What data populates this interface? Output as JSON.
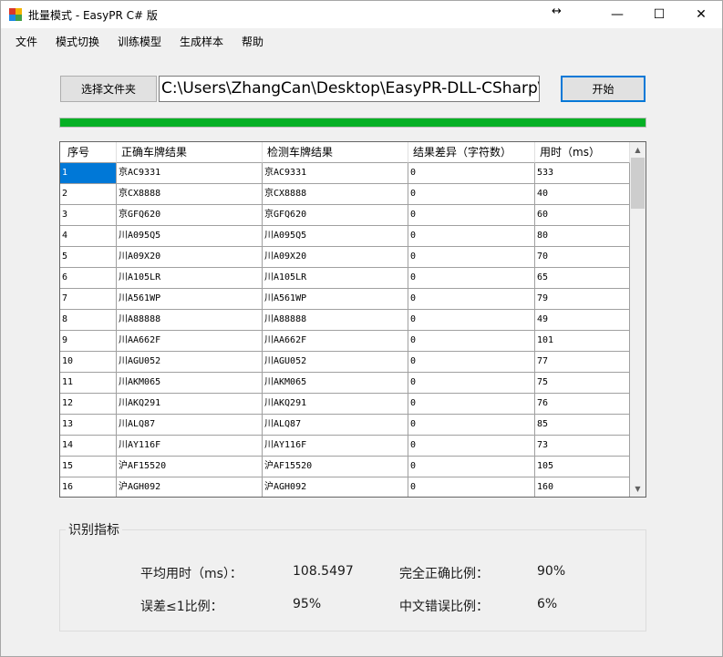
{
  "window": {
    "title": "批量模式 - EasyPR C# 版",
    "minimize_glyph": "—",
    "maximize_glyph": "☐",
    "close_glyph": "✕",
    "resize_glyph": "↔"
  },
  "menu": [
    "文件",
    "模式切换",
    "训练模型",
    "生成样本",
    "帮助"
  ],
  "toolbar": {
    "select_folder_label": "选择文件夹",
    "path_value": "C:\\Users\\ZhangCan\\Desktop\\EasyPR-DLL-CSharp\\demo",
    "start_label": "开始"
  },
  "progress": {
    "percent": 100,
    "color": "#06b025"
  },
  "table": {
    "headers": [
      "序号",
      "正确车牌结果",
      "检测车牌结果",
      "结果差异（字符数）",
      "用时（ms）"
    ],
    "rows": [
      [
        "1",
        "京AC9331",
        "京AC9331",
        "0",
        "533"
      ],
      [
        "2",
        "京CX8888",
        "京CX8888",
        "0",
        "40"
      ],
      [
        "3",
        "京GFQ620",
        "京GFQ620",
        "0",
        "60"
      ],
      [
        "4",
        "川A095Q5",
        "川A095Q5",
        "0",
        "80"
      ],
      [
        "5",
        "川A09X20",
        "川A09X20",
        "0",
        "70"
      ],
      [
        "6",
        "川A105LR",
        "川A105LR",
        "0",
        "65"
      ],
      [
        "7",
        "川A561WP",
        "川A561WP",
        "0",
        "79"
      ],
      [
        "8",
        "川A88888",
        "川A88888",
        "0",
        "49"
      ],
      [
        "9",
        "川AA662F",
        "川AA662F",
        "0",
        "101"
      ],
      [
        "10",
        "川AGU052",
        "川AGU052",
        "0",
        "77"
      ],
      [
        "11",
        "川AKM065",
        "川AKM065",
        "0",
        "75"
      ],
      [
        "12",
        "川AKQ291",
        "川AKQ291",
        "0",
        "76"
      ],
      [
        "13",
        "川ALQ87",
        "川ALQ87",
        "0",
        "85"
      ],
      [
        "14",
        "川AY116F",
        "川AY116F",
        "0",
        "73"
      ],
      [
        "15",
        "沪AF15520",
        "沪AF15520",
        "0",
        "105"
      ],
      [
        "16",
        "沪AGH092",
        "沪AGH092",
        "0",
        "160"
      ]
    ],
    "selected_cell": [
      0,
      0
    ]
  },
  "metrics": {
    "group_title": "识别指标",
    "avg_time_label": "平均用时（ms）：",
    "avg_time_value": "108.5497",
    "exact_ratio_label": "完全正确比例：",
    "exact_ratio_value": "90%",
    "error_le1_label": "误差≤1比例：",
    "error_le1_value": "95%",
    "chinese_error_label": "中文错误比例：",
    "chinese_error_value": "6%"
  },
  "icons": {
    "app": "app-icon",
    "scroll_up": "chevron-up-icon",
    "scroll_down": "chevron-down-icon"
  }
}
